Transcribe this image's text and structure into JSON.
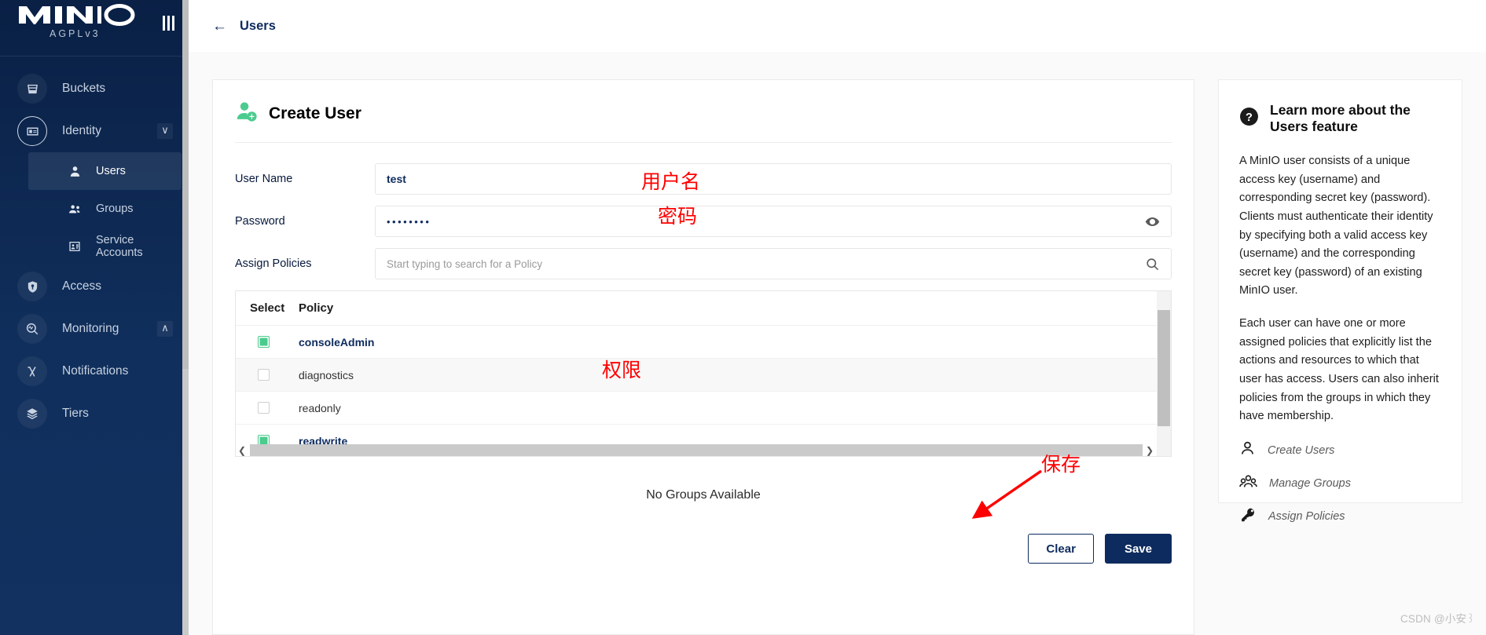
{
  "sidebar": {
    "logo": "MINIO",
    "license": "AGPLv3",
    "hamburger_icon": "hamburger-icon",
    "items": [
      {
        "label": "Buckets",
        "icon": "bucket-icon",
        "type": "top"
      },
      {
        "label": "Identity",
        "icon": "identity-card-icon",
        "type": "top",
        "chevron": "∨",
        "expanded": true
      },
      {
        "label": "Users",
        "icon": "user-icon",
        "type": "sub",
        "active": true
      },
      {
        "label": "Groups",
        "icon": "group-icon",
        "type": "sub",
        "active": false
      },
      {
        "label": "Service Accounts",
        "icon": "service-account-icon",
        "type": "sub",
        "active": false
      },
      {
        "label": "Access",
        "icon": "lock-shield-icon",
        "type": "top"
      },
      {
        "label": "Monitoring",
        "icon": "monitoring-magnifier-icon",
        "type": "top",
        "chevron": "∧",
        "expanded": false
      },
      {
        "label": "Notifications",
        "icon": "lambda-icon",
        "type": "top"
      },
      {
        "label": "Tiers",
        "icon": "layers-icon",
        "type": "top"
      }
    ]
  },
  "topbar": {
    "back_icon": "←",
    "breadcrumb": "Users"
  },
  "form": {
    "icon": "add-user-icon",
    "title": "Create User",
    "fields": {
      "username": {
        "label": "User Name",
        "value": "test",
        "placeholder": ""
      },
      "password": {
        "label": "Password",
        "value": "••••••••",
        "toggle_icon": "eye-icon"
      },
      "policies": {
        "label": "Assign Policies",
        "value": "",
        "placeholder": "Start typing to search for a Policy",
        "search_icon": "search-icon"
      }
    },
    "policy_table": {
      "columns": [
        "Select",
        "Policy"
      ],
      "rows": [
        {
          "policy": "consoleAdmin",
          "selected": true
        },
        {
          "policy": "diagnostics",
          "selected": false
        },
        {
          "policy": "readonly",
          "selected": false
        },
        {
          "policy": "readwrite",
          "selected": true
        }
      ]
    },
    "groups_empty_message": "No Groups Available",
    "buttons": {
      "clear": "Clear",
      "save": "Save"
    }
  },
  "help": {
    "icon": "question-mark-icon",
    "title": "Learn more about the Users feature",
    "paragraphs": [
      "A MinIO user consists of a unique access key (username) and corresponding secret key (password). Clients must authenticate their identity by specifying both a valid access key (username) and the corresponding secret key (password) of an existing MinIO user.",
      "Each user can have one or more assigned policies that explicitly list the actions and resources to which that user has access. Users can also inherit policies from the groups in which they have membership."
    ],
    "links": [
      {
        "label": "Create Users",
        "icon": "single-user-icon"
      },
      {
        "label": "Manage Groups",
        "icon": "multi-user-icon"
      },
      {
        "label": "Assign Policies",
        "icon": "key-icon"
      }
    ]
  },
  "annotations": {
    "username": "用户名",
    "password": "密码",
    "permissions": "权限",
    "save": "保存",
    "arrow": "red-arrow-annotation",
    "color": "#ff0000"
  },
  "watermark": "CSDN @小安꒱",
  "colors": {
    "sidebar_bg": "#0d2b5e",
    "accent_navy": "#0d2b5e",
    "checkbox_green": "#4ccb8e",
    "annotation_red": "#ff0000"
  }
}
